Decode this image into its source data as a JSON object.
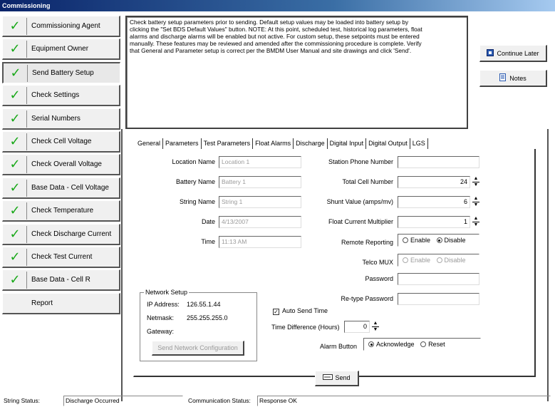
{
  "window": {
    "title": "Commissioning"
  },
  "steps": [
    {
      "label": "Commissioning Agent",
      "checked": true
    },
    {
      "label": "Equipment Owner",
      "checked": true
    },
    {
      "label": "Send Battery Setup",
      "checked": true
    },
    {
      "label": "Check Settings",
      "checked": true
    },
    {
      "label": "Serial Numbers",
      "checked": true
    },
    {
      "label": "Check Cell Voltage",
      "checked": true
    },
    {
      "label": "Check Overall Voltage",
      "checked": true
    },
    {
      "label": "Base Data - Cell Voltage",
      "checked": true
    },
    {
      "label": "Check Temperature",
      "checked": true
    },
    {
      "label": "Check Discharge Current",
      "checked": true
    },
    {
      "label": "Check Test Current",
      "checked": true
    },
    {
      "label": "Base Data - Cell R",
      "checked": true
    },
    {
      "label": "Report",
      "checked": false
    }
  ],
  "instructions": "Check battery setup parameters prior to sending. Default setup values may be loaded into battery setup by clicking the \"Set BDS Default Values\" button. NOTE: At this point, scheduled test, historical log parameters, float alarms and discharge alarms will be enabled but not active. For custom setup, these setpoints must be entered manually. These features may be reviewed and amended after the commissioning procedure is complete. Verify that General and Parameter setup is correct per the BMDM User Manual and site drawings and click 'Send'.",
  "buttons": {
    "continue_later": "Continue Later",
    "notes": "Notes",
    "send": "Send",
    "send_network_config": "Send Network Configuration"
  },
  "tabs": [
    "General",
    "Parameters",
    "Test Parameters",
    "Float Alarms",
    "Discharge",
    "Digital Input",
    "Digital Output",
    "LGS"
  ],
  "general": {
    "location_name_label": "Location Name",
    "location_name": "Location 1",
    "battery_name_label": "Battery Name",
    "battery_name": "Battery 1",
    "string_name_label": "String Name",
    "string_name": "String 1",
    "date_label": "Date",
    "date": "4/13/2007",
    "time_label": "Time",
    "time": "11:13 AM",
    "station_phone_label": "Station Phone Number",
    "station_phone": "",
    "total_cell_label": "Total Cell Number",
    "total_cell": "24",
    "shunt_label": "Shunt Value (amps/mv)",
    "shunt": "6",
    "float_mult_label": "Float Current Multiplier",
    "float_mult": "1",
    "remote_reporting_label": "Remote Reporting",
    "telco_mux_label": "Telco MUX",
    "enable": "Enable",
    "disable": "Disable",
    "password_label": "Password",
    "retype_password_label": "Re-type Password",
    "auto_send_time": "Auto Send Time",
    "time_diff_label": "Time Difference (Hours)",
    "time_diff": "0",
    "alarm_button_label": "Alarm Button",
    "acknowledge": "Acknowledge",
    "reset": "Reset"
  },
  "network": {
    "legend": "Network Setup",
    "ip_label": "IP Address:",
    "ip": "126.55.1.44",
    "netmask_label": "Netmask:",
    "netmask": "255.255.255.0",
    "gateway_label": "Gateway:",
    "gateway": ""
  },
  "status": {
    "string_label": "String Status:",
    "string_value": "Discharge Occurred",
    "comm_label": "Communication Status:",
    "comm_value": "Response OK"
  },
  "colors": {
    "check": "#18a818",
    "titlebar": "#0a246a"
  }
}
